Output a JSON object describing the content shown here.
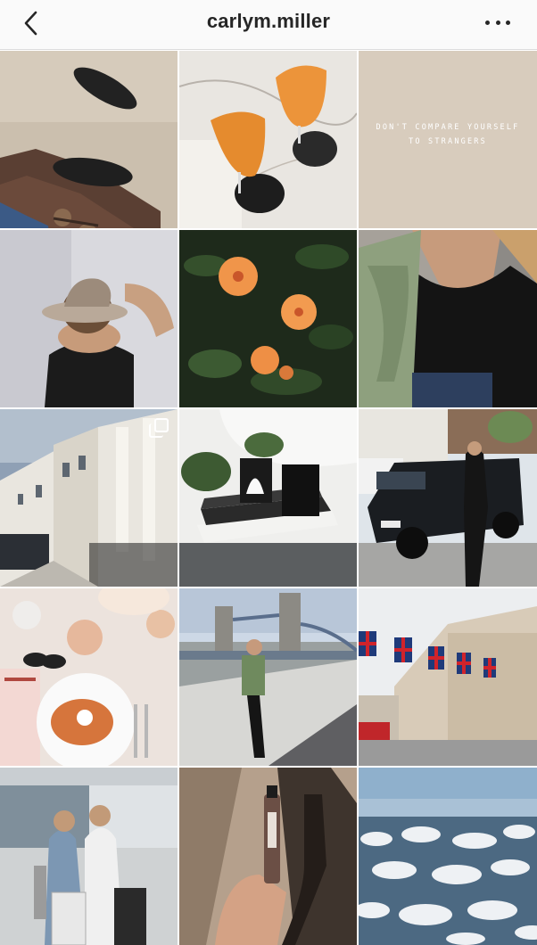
{
  "header": {
    "title": "carlym.miller",
    "back_icon": "chevron-left-icon",
    "more_icon": "more-horizontal-icon"
  },
  "posts": [
    {
      "id": 1,
      "subject": "beach-sandals-sunglasses"
    },
    {
      "id": 2,
      "subject": "spritz-drinks-marble-table"
    },
    {
      "id": 3,
      "subject": "quote-card",
      "quote_lines": [
        "DON'T COMPARE YOURSELF",
        "TO STRANGERS"
      ]
    },
    {
      "id": 4,
      "subject": "woman-in-hat"
    },
    {
      "id": 5,
      "subject": "orange-hibiscus-flowers"
    },
    {
      "id": 6,
      "subject": "green-jacket-black-top"
    },
    {
      "id": 7,
      "subject": "white-terraced-houses",
      "carousel_icon": "multiple-photos-icon"
    },
    {
      "id": 8,
      "subject": "books-candles-shelf"
    },
    {
      "id": 9,
      "subject": "black-land-rover-street"
    },
    {
      "id": 10,
      "subject": "brunch-table-spread"
    },
    {
      "id": 11,
      "subject": "tower-bridge-portrait"
    },
    {
      "id": 12,
      "subject": "union-jack-flags-street"
    },
    {
      "id": 13,
      "subject": "airport-friends-luggage"
    },
    {
      "id": 14,
      "subject": "perfume-bottle-hand-shadow"
    },
    {
      "id": 15,
      "subject": "clouds-from-airplane"
    }
  ],
  "colors": {
    "header_bg": "#fafafa",
    "text": "#262626",
    "divider": "#dcdcdc",
    "quote_bg": "#d8ccbd"
  }
}
